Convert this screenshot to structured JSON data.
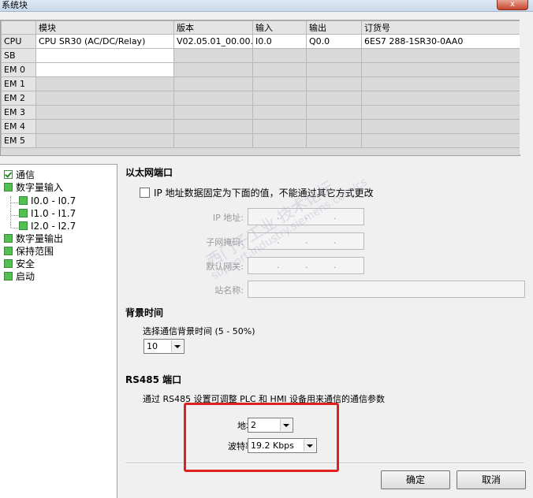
{
  "window": {
    "title": "系统块",
    "close_glyph": "x"
  },
  "module_table": {
    "headers": [
      "",
      "模块",
      "版本",
      "输入",
      "输出",
      "订货号"
    ],
    "rows": [
      [
        "CPU",
        "CPU SR30 (AC/DC/Relay)",
        "V02.05.01_00.00...",
        "I0.0",
        "Q0.0",
        "6ES7 288-1SR30-0AA0"
      ],
      [
        "SB",
        "",
        "",
        "",
        "",
        ""
      ],
      [
        "EM 0",
        "",
        "",
        "",
        "",
        ""
      ],
      [
        "EM 1",
        "",
        "",
        "",
        "",
        ""
      ],
      [
        "EM 2",
        "",
        "",
        "",
        "",
        ""
      ],
      [
        "EM 3",
        "",
        "",
        "",
        "",
        ""
      ],
      [
        "EM 4",
        "",
        "",
        "",
        "",
        ""
      ],
      [
        "EM 5",
        "",
        "",
        "",
        "",
        ""
      ]
    ]
  },
  "tree": {
    "items": [
      {
        "label": "通信",
        "state": "checked"
      },
      {
        "label": "数字量输入",
        "state": "green"
      },
      {
        "label": "I0.0 - I0.7",
        "state": "green",
        "child": true
      },
      {
        "label": "I1.0 - I1.7",
        "state": "green",
        "child": true
      },
      {
        "label": "I2.0 - I2.7",
        "state": "green",
        "child": true
      },
      {
        "label": "数字量输出",
        "state": "green"
      },
      {
        "label": "保持范围",
        "state": "green"
      },
      {
        "label": "安全",
        "state": "green"
      },
      {
        "label": "启动",
        "state": "green"
      }
    ]
  },
  "ethernet": {
    "section_title": "以太网端口",
    "fixed_ip_label": "IP 地址数据固定为下面的值，不能通过其它方式更改",
    "ip_label": "IP 地址:",
    "subnet_label": "子网掩码:",
    "gateway_label": "默认网关:",
    "station_label": "站名称:",
    "ip_dots": "."
  },
  "background_time": {
    "section_title": "背景时间",
    "select_label": "选择通信背景时间 (5 - 50%)",
    "value": "10"
  },
  "rs485": {
    "section_title": "RS485 端口",
    "description": "通过 RS485 设置可调整 PLC 和 HMI 设备用来通信的通信参数",
    "address_label": "地址:",
    "address_value": "2",
    "baud_label": "波特率:",
    "baud_value": "19.2 Kbps"
  },
  "buttons": {
    "ok": "确定",
    "cancel": "取消"
  },
  "watermark": {
    "text1": "西门子工业 技术论坛",
    "text2": "support.industry.siemens.com/cs"
  },
  "colors": {
    "highlight": "#e0201e",
    "tree_check": "#52c152"
  }
}
